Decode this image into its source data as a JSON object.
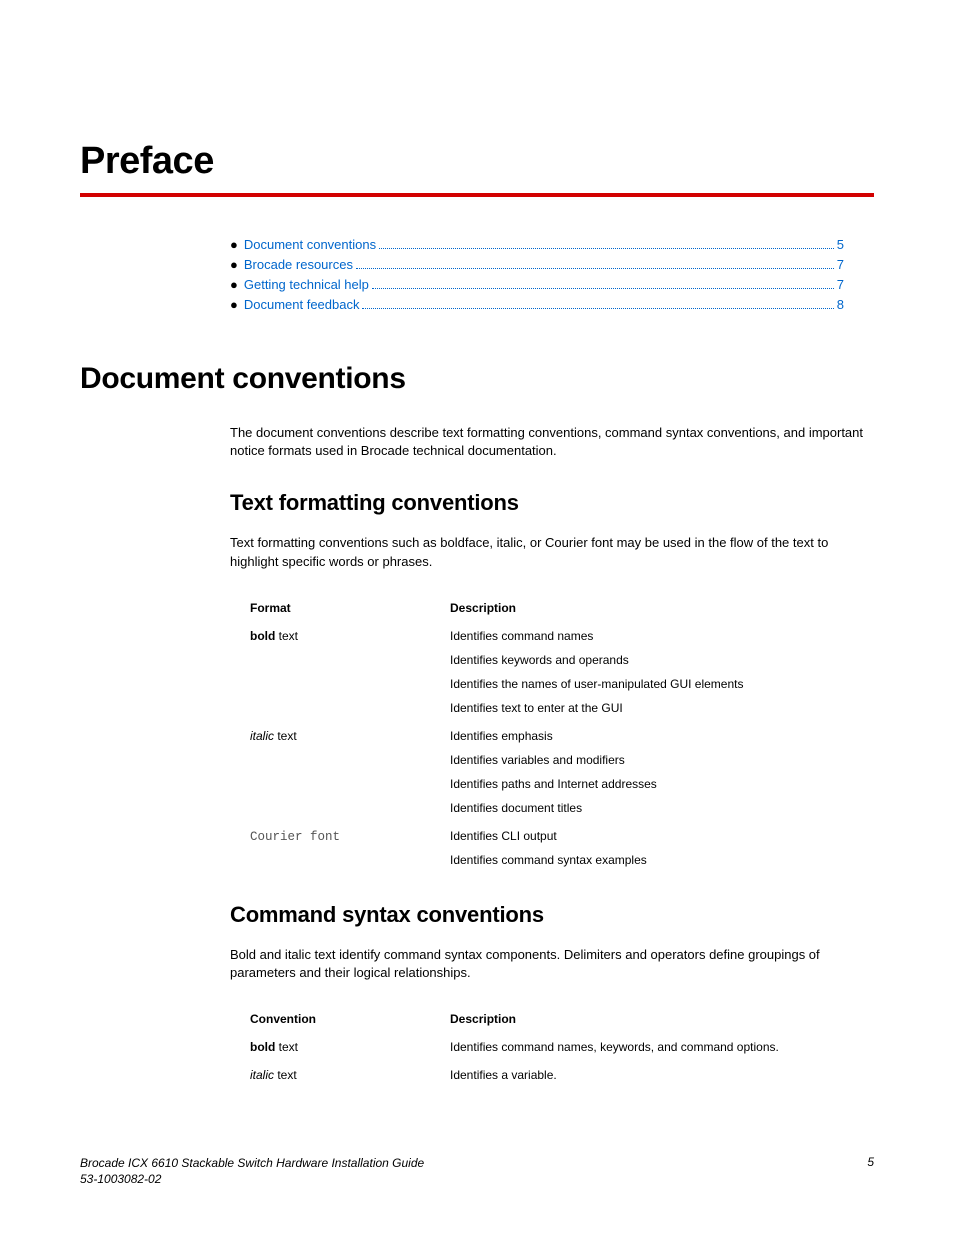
{
  "title": "Preface",
  "toc": [
    {
      "label": "Document conventions",
      "page": "5"
    },
    {
      "label": "Brocade resources",
      "page": "7"
    },
    {
      "label": "Getting technical help",
      "page": "7"
    },
    {
      "label": "Document feedback",
      "page": "8"
    }
  ],
  "section1": {
    "heading": "Document conventions",
    "intro": "The document conventions describe text formatting conventions, command syntax conventions, and important notice formats used in Brocade technical documentation."
  },
  "sub1": {
    "heading": "Text formatting conventions",
    "intro": "Text formatting conventions such as boldface, italic, or Courier font may be used in the flow of the text to highlight specific words or phrases.",
    "table": {
      "h1": "Format",
      "h2": "Description",
      "rows": [
        {
          "fmt_strong": "bold",
          "fmt_plain": " text",
          "fmt_class": "bold-part",
          "desc": [
            "Identifies command names",
            "Identifies keywords and operands",
            "Identifies the names of user-manipulated GUI elements",
            "Identifies text to enter at the GUI"
          ]
        },
        {
          "fmt_strong": "italic",
          "fmt_plain": " text",
          "fmt_class": "italic-part",
          "desc": [
            "Identifies emphasis",
            "Identifies variables and modifiers",
            "Identifies paths and Internet addresses",
            "Identifies document titles"
          ]
        },
        {
          "fmt_strong": "Courier font",
          "fmt_plain": "",
          "fmt_class": "courier-part",
          "desc": [
            "Identifies CLI output",
            "Identifies command syntax examples"
          ]
        }
      ]
    }
  },
  "sub2": {
    "heading": "Command syntax conventions",
    "intro": "Bold and italic text identify command syntax components. Delimiters and operators define groupings of parameters and their logical relationships.",
    "table": {
      "h1": "Convention",
      "h2": "Description",
      "rows": [
        {
          "fmt_strong": "bold",
          "fmt_plain": " text",
          "fmt_class": "bold-part",
          "desc": [
            "Identifies command names, keywords, and command options."
          ]
        },
        {
          "fmt_strong": "italic",
          "fmt_plain": " text",
          "fmt_class": "italic-part",
          "desc": [
            "Identifies a variable."
          ]
        }
      ]
    }
  },
  "footer": {
    "line1": "Brocade ICX 6610 Stackable Switch Hardware Installation Guide",
    "line2": "53-1003082-02",
    "page": "5"
  }
}
